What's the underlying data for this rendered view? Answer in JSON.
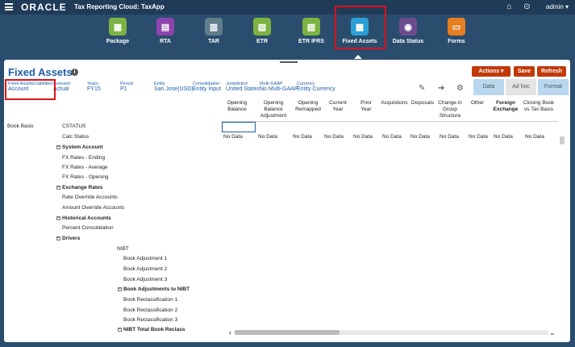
{
  "header": {
    "logo": "ORACLE",
    "app_title": "Tax Reporting Cloud: TaxApp",
    "user": "admin ▾"
  },
  "nav": [
    {
      "label": "Package",
      "color": "#7cb342"
    },
    {
      "label": "RTA",
      "color": "#8e44ad"
    },
    {
      "label": "TAR",
      "color": "#607d8b"
    },
    {
      "label": "ETR",
      "color": "#7cb342"
    },
    {
      "label": "ETR IFRS",
      "color": "#7cb342"
    },
    {
      "label": "Fixed Assets",
      "color": "#2a9fd6"
    },
    {
      "label": "Data Status",
      "color": "#6d4c8e"
    },
    {
      "label": "Forms",
      "color": "#e67e22"
    }
  ],
  "page": {
    "title": "Fixed Assets",
    "actions": "Actions ▾",
    "save": "Save",
    "refresh": "Refresh"
  },
  "pov": [
    {
      "label": "Fixed Assets/Liabilities",
      "value": "Account"
    },
    {
      "label": "Scenario",
      "value": "Actual"
    },
    {
      "label": "Years",
      "value": "FY15"
    },
    {
      "label": "Period",
      "value": "P1"
    },
    {
      "label": "Entity",
      "value": "San Jose(USD)"
    },
    {
      "label": "Consolidation",
      "value": "Entity Input"
    },
    {
      "label": "Jurisdiction",
      "value": "United States"
    },
    {
      "label": "Multi-GAAP",
      "value": "No Multi-GAAP"
    },
    {
      "label": "Currency",
      "value": "Entity Currency"
    }
  ],
  "tabs": {
    "data": "Data",
    "adhoc": "Ad hoc",
    "format": "Format"
  },
  "columns": [
    "Opening Balance",
    "Opening Balance Adjustment",
    "Opening Remapped",
    "Current Year",
    "Prior Year",
    "Acquistions",
    "Disposals",
    "Change in Group Structure",
    "Other",
    "Foreign Exchange",
    "Closing Book vs Tax Basis"
  ],
  "row_header": "Book Basis",
  "rows": [
    {
      "label": "CSTATUS",
      "bold": false,
      "exp": false
    },
    {
      "label": "Calc Status",
      "bold": false,
      "exp": false
    },
    {
      "label": "System Account",
      "bold": true,
      "exp": true
    },
    {
      "label": "FX Rates - Ending",
      "bold": false,
      "exp": false
    },
    {
      "label": "FX Rates - Average",
      "bold": false,
      "exp": false
    },
    {
      "label": "FX Rates - Opening",
      "bold": false,
      "exp": false
    },
    {
      "label": "Exchange Rates",
      "bold": true,
      "exp": true
    },
    {
      "label": "Rate Override Accounts",
      "bold": false,
      "exp": false
    },
    {
      "label": "Amount Override Accounts",
      "bold": false,
      "exp": false
    },
    {
      "label": "Historical Accounts",
      "bold": true,
      "exp": true
    },
    {
      "label": "Percent Consolidation",
      "bold": false,
      "exp": false
    },
    {
      "label": "Drivers",
      "bold": true,
      "exp": true
    },
    {
      "label": "NIBT",
      "bold": false,
      "exp": false
    },
    {
      "label": "Book Adjustment 1",
      "bold": false,
      "exp": false
    },
    {
      "label": "Book Adjustment 2",
      "bold": false,
      "exp": false
    },
    {
      "label": "Book Adjustment 3",
      "bold": false,
      "exp": false
    },
    {
      "label": "Book Adjustments to NIBT",
      "bold": true,
      "exp": true
    },
    {
      "label": "Book Reclassification 1",
      "bold": false,
      "exp": false
    },
    {
      "label": "Book Reclassification 2",
      "bold": false,
      "exp": false
    },
    {
      "label": "Book Reclassification 3",
      "bold": false,
      "exp": false
    },
    {
      "label": "NIBT Total Book Reclass",
      "bold": true,
      "exp": true
    }
  ],
  "nodata": "No Data"
}
